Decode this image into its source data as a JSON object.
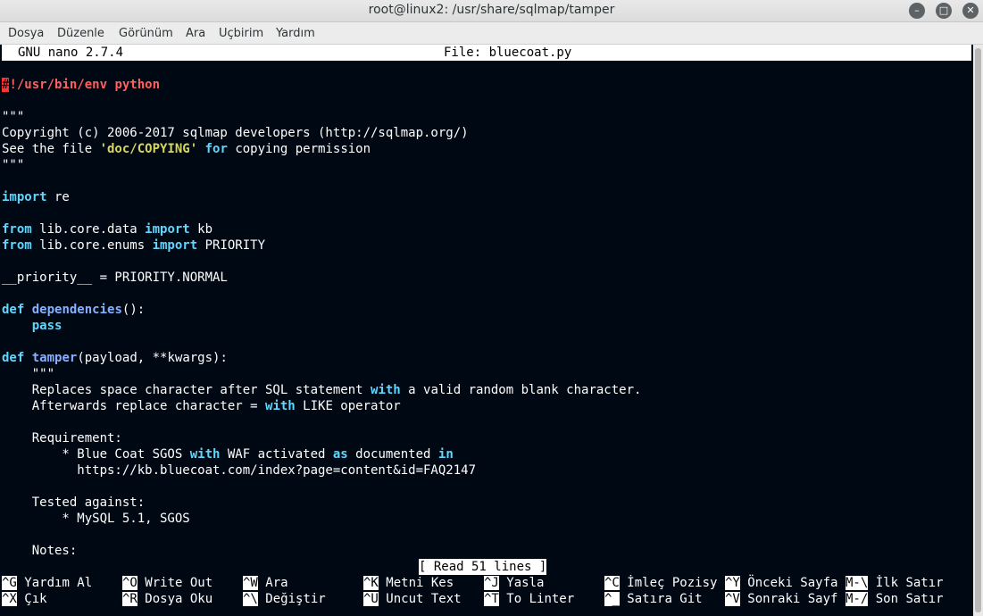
{
  "window": {
    "title": "root@linux2: /usr/share/sqlmap/tamper"
  },
  "menu": [
    "Dosya",
    "Düzenle",
    "Görünüm",
    "Ara",
    "Uçbirim",
    "Yardım"
  ],
  "nano": {
    "version": "GNU nano 2.7.4",
    "file": "File: bluecoat.py",
    "status": "[ Read 51 lines ]"
  },
  "code": {
    "shebang_first": "#",
    "shebang_rest": "!/usr/bin/env python",
    "docq": "\"\"\"",
    "copyright": "Copyright (c) 2006-2017 sqlmap developers (http://sqlmap.org/)",
    "see_a": "See the file ",
    "see_str": "'doc/COPYING'",
    "see_for": "for",
    "see_b": " copying permission",
    "import": "import",
    "re": " re",
    "from": "from",
    "lib_data": " lib.core.data ",
    "kb": " kb",
    "lib_enums": " lib.core.enums ",
    "priority": " PRIORITY",
    "prio_line": "__priority__ = PRIORITY.NORMAL",
    "def": "def",
    "dependencies": "dependencies",
    "dep_args": "():",
    "pass": "pass",
    "tamper": "tamper",
    "tamper_args": "(payload, **kwargs):",
    "indent_doc": "    \"\"\"",
    "rep_a": "    Replaces space character after SQL statement ",
    "with": "with",
    "rep_b": " a valid random blank character.",
    "after_a": "    Afterwards replace character = ",
    "after_b": " LIKE operator",
    "req": "    Requirement:",
    "blue_a": "        * Blue Coat SGOS ",
    "blue_b": " WAF activated ",
    "as": "as",
    "blue_c": " documented ",
    "in": "in",
    "url": "          https://kb.bluecoat.com/index?page=content&id=FAQ2147",
    "tested": "    Tested against:",
    "mysql": "        * MySQL 5.1, SGOS",
    "notes": "    Notes:"
  },
  "shortcuts": [
    {
      "key": "^G",
      "label": "Yardım Al"
    },
    {
      "key": "^O",
      "label": "Write Out"
    },
    {
      "key": "^W",
      "label": "Ara"
    },
    {
      "key": "^K",
      "label": "Metni Kes"
    },
    {
      "key": "^J",
      "label": "Yasla"
    },
    {
      "key": "^C",
      "label": "İmleç Pozisy"
    },
    {
      "key": "^Y",
      "label": "Önceki Sayfa"
    },
    {
      "key": "M-\\",
      "label": "İlk Satır"
    },
    {
      "key": "^X",
      "label": "Çık"
    },
    {
      "key": "^R",
      "label": "Dosya Oku"
    },
    {
      "key": "^\\",
      "label": "Değiştir"
    },
    {
      "key": "^U",
      "label": "Uncut Text"
    },
    {
      "key": "^T",
      "label": "To Linter"
    },
    {
      "key": "^_",
      "label": "Satıra Git"
    },
    {
      "key": "^V",
      "label": "Sonraki Sayf"
    },
    {
      "key": "M-/",
      "label": "Son Satır"
    }
  ]
}
